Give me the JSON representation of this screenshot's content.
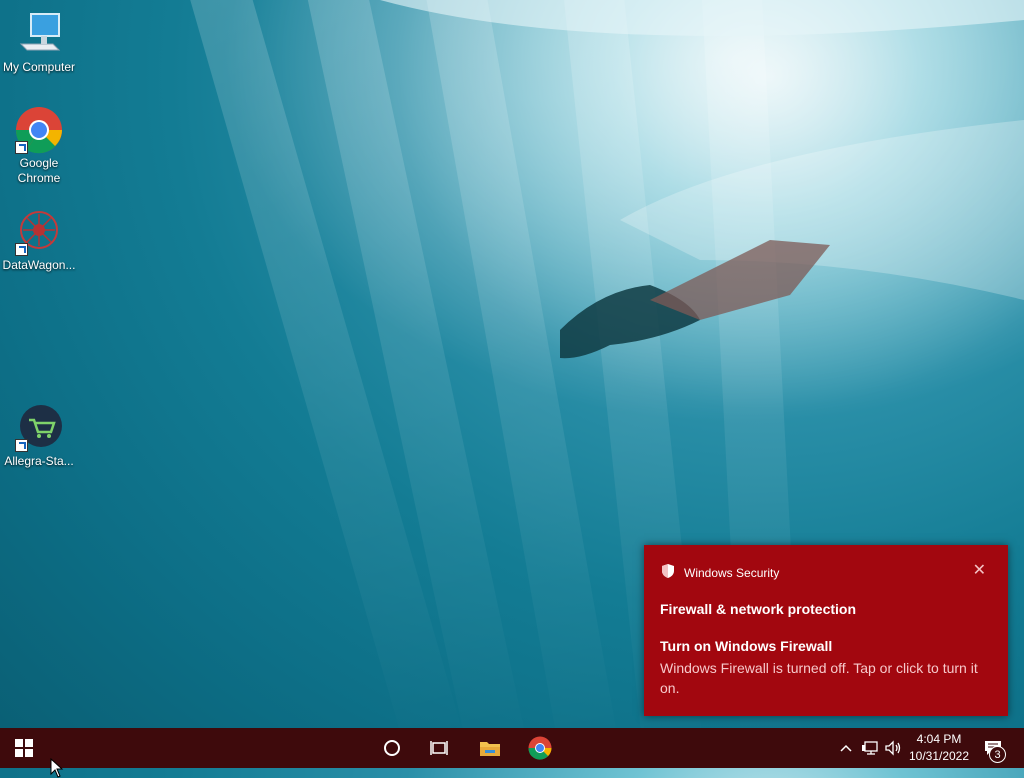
{
  "desktop": {
    "icons": [
      {
        "label": "My Computer",
        "icon": "computer-icon"
      },
      {
        "label": "Google\nChrome",
        "icon": "chrome-icon"
      },
      {
        "label": "DataWagon...",
        "icon": "datawagon-icon"
      },
      {
        "label": "Allegra-Sta...",
        "icon": "shopping-cart-icon"
      }
    ]
  },
  "toast": {
    "app_name": "Windows Security",
    "title": "Firewall & network protection",
    "subtitle": "Turn on Windows Firewall",
    "body": "Windows Firewall is turned off. Tap or click to turn it on.",
    "close_icon": "close-icon",
    "background": "#a2070f"
  },
  "taskbar": {
    "background": "#3e0a0c",
    "time": "4:04 PM",
    "date": "10/31/2022",
    "notification_count": "3"
  }
}
